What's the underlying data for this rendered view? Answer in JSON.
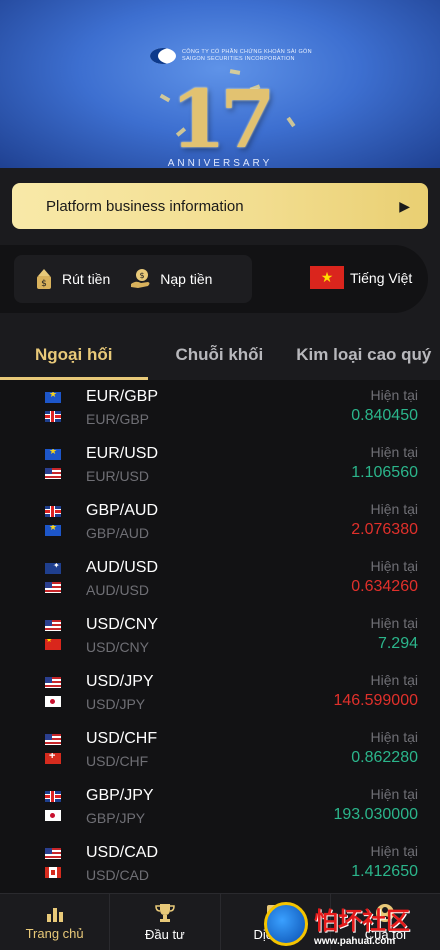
{
  "banner": {
    "brand_line_1": "CÔNG TY CỔ PHẦN CHỨNG KHOÁN SÀI GÒN",
    "brand_line_2": "SAIGON SECURITIES INCORPORATION",
    "anniversary_number": "17",
    "anniversary_label": "ANNIVERSARY"
  },
  "info_bar": {
    "label": "Platform business information",
    "chevron_icon": "chevron-right-icon"
  },
  "actions": {
    "withdraw": {
      "label": "Rút tiền",
      "icon": "withdraw-money-icon"
    },
    "deposit": {
      "label": "Nạp tiền",
      "icon": "deposit-money-icon"
    },
    "language": {
      "label": "Tiếng Việt",
      "icon": "vietnam-flag-icon"
    }
  },
  "tabs": [
    {
      "label": "Ngoại hối",
      "active": true
    },
    {
      "label": "Chuỗi khối",
      "active": false
    },
    {
      "label": "Kim loại cao quý",
      "active": false
    }
  ],
  "current_label": "Hiện tại",
  "pairs": [
    {
      "pair": "EUR/GBP",
      "sub": "EUR/GBP",
      "price": "0.840450",
      "trend": "up",
      "flags": [
        "eu",
        "gb"
      ]
    },
    {
      "pair": "EUR/USD",
      "sub": "EUR/USD",
      "price": "1.106560",
      "trend": "up",
      "flags": [
        "eu",
        "us"
      ]
    },
    {
      "pair": "GBP/AUD",
      "sub": "GBP/AUD",
      "price": "2.076380",
      "trend": "down",
      "flags": [
        "gb",
        "eu"
      ]
    },
    {
      "pair": "AUD/USD",
      "sub": "AUD/USD",
      "price": "0.634260",
      "trend": "down",
      "flags": [
        "au",
        "us"
      ]
    },
    {
      "pair": "USD/CNY",
      "sub": "USD/CNY",
      "price": "7.294",
      "trend": "up",
      "flags": [
        "us",
        "cn"
      ]
    },
    {
      "pair": "USD/JPY",
      "sub": "USD/JPY",
      "price": "146.599000",
      "trend": "down",
      "flags": [
        "us",
        "jp"
      ]
    },
    {
      "pair": "USD/CHF",
      "sub": "USD/CHF",
      "price": "0.862280",
      "trend": "up",
      "flags": [
        "us",
        "ch"
      ]
    },
    {
      "pair": "GBP/JPY",
      "sub": "GBP/JPY",
      "price": "193.030000",
      "trend": "up",
      "flags": [
        "gb",
        "jp"
      ]
    },
    {
      "pair": "USD/CAD",
      "sub": "USD/CAD",
      "price": "1.412650",
      "trend": "up",
      "flags": [
        "us",
        "ca"
      ]
    }
  ],
  "nav": [
    {
      "label": "Trang chủ",
      "icon": "home-chart-icon"
    },
    {
      "label": "Đầu tư",
      "icon": "trophy-icon"
    },
    {
      "label": "Dịch vụ",
      "icon": "service-icon"
    },
    {
      "label": "Của tôi",
      "icon": "user-icon"
    }
  ],
  "watermark": {
    "title": "怕坏社区",
    "url": "www.pahuai.com"
  },
  "colors": {
    "gold": "#e8c979",
    "up": "#2bb58b",
    "down": "#e0302b",
    "background": "#111113"
  }
}
